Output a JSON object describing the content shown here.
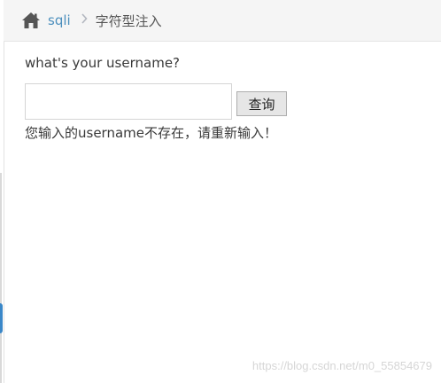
{
  "breadcrumb": {
    "home_icon": "home-icon",
    "link_label": "sqli",
    "separator": "›",
    "current_label": "字符型注入"
  },
  "form": {
    "prompt": "what's your username?",
    "input_value": "",
    "submit_label": "查询"
  },
  "result": {
    "message": "您输入的username不存在，请重新输入！"
  },
  "watermark": "https://blog.csdn.net/m0_55854679",
  "colors": {
    "link": "#4c8fbd",
    "breadcrumb_bg": "#f5f5f5",
    "text": "#393939",
    "button_bg": "#e6e6e6"
  }
}
